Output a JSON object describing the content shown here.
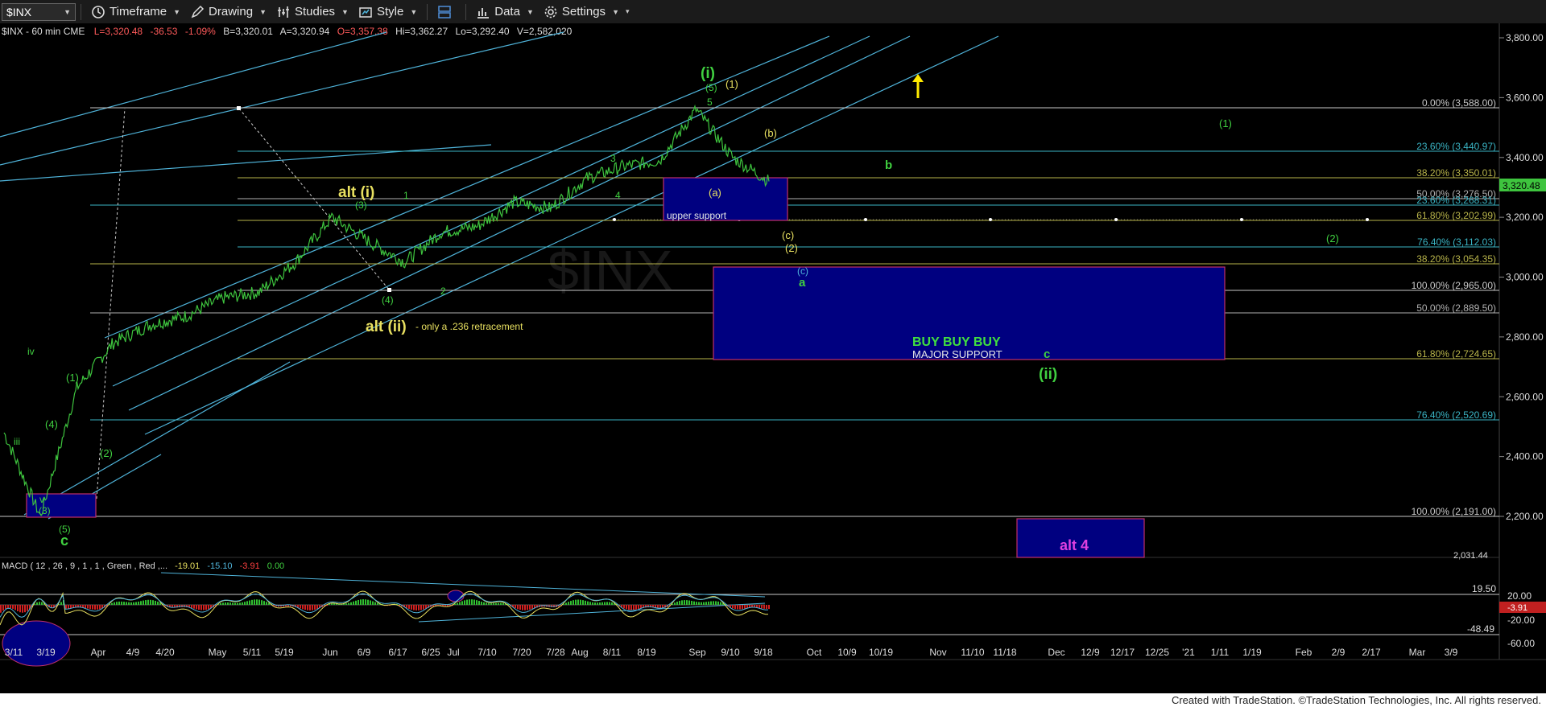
{
  "toolbar": {
    "symbol": "$INX",
    "timeframe": "Timeframe",
    "drawing": "Drawing",
    "studies": "Studies",
    "style": "Style",
    "data": "Data",
    "settings": "Settings"
  },
  "header": {
    "symbol_info": "$INX - 60 min  CME",
    "last": "L=3,320.48",
    "change": "-36.53",
    "change_pct": "-1.09%",
    "bid": "B=3,320.01",
    "ask": "A=3,320.94",
    "open": "O=3,357.38",
    "high": "Hi=3,362.27",
    "low": "Lo=3,292.40",
    "volume": "V=2,582,020"
  },
  "price_axis": {
    "ticks": [
      "3,800.00",
      "3,600.00",
      "3,400.00",
      "3,200.00",
      "3,000.00",
      "2,800.00",
      "2,600.00",
      "2,400.00",
      "2,200.00"
    ],
    "last_price": "3,320.48",
    "bottom_clip": "2,031.44"
  },
  "macd_axis": {
    "ticks": [
      "20.00",
      "-20.00",
      "-60.00"
    ],
    "upper_line": "19.50",
    "lower_line": "-48.49",
    "current": "-3.91"
  },
  "time_axis": [
    "3/11",
    "3/19",
    "Apr",
    "4/9",
    "4/20",
    "May",
    "5/11",
    "5/19",
    "Jun",
    "6/9",
    "6/17",
    "6/25",
    "Jul",
    "7/10",
    "7/20",
    "7/28",
    "Aug",
    "8/11",
    "8/19",
    "Sep",
    "9/10",
    "9/18",
    "Oct",
    "10/9",
    "10/19",
    "Nov",
    "11/10",
    "11/18",
    "Dec",
    "12/9",
    "12/17",
    "12/25",
    "'21",
    "1/11",
    "1/19",
    "Feb",
    "2/9",
    "2/17",
    "Mar",
    "3/9"
  ],
  "fib_levels": [
    {
      "label": "0.00% (3,588.00)",
      "color": "#c8c8c8"
    },
    {
      "label": "23.60% (3,440.97)",
      "color": "#3ab4c4"
    },
    {
      "label": "38.20% (3,350.01)",
      "color": "#b8b44a"
    },
    {
      "label": "50.00% (3,276.50)",
      "color": "#b0b0b0"
    },
    {
      "label": "23.60% (3,268.31)",
      "color": "#3ab4c4"
    },
    {
      "label": "61.80% (3,202.99)",
      "color": "#b8b44a"
    },
    {
      "label": "76.40% (3,112.03)",
      "color": "#3ab4c4"
    },
    {
      "label": "38.20% (3,054.35)",
      "color": "#b8b44a"
    },
    {
      "label": "100.00% (2,965.00)",
      "color": "#c8c8c8"
    },
    {
      "label": "50.00% (2,889.50)",
      "color": "#b0b0b0"
    },
    {
      "label": "61.80% (2,724.65)",
      "color": "#b8b44a"
    },
    {
      "label": "76.40% (2,520.69)",
      "color": "#3ab4c4"
    },
    {
      "label": "100.00% (2,191.00)",
      "color": "#c8c8c8"
    }
  ],
  "annotations": {
    "alt_i": "alt (i)",
    "alt_ii": "alt (ii)",
    "alt_ii_note": "- only a .236 retracement",
    "wave_i": "(i)",
    "wave_ii": "(ii)",
    "upper_support": "upper support",
    "buy": "BUY BUY BUY",
    "major_support": "MAJOR SUPPORT",
    "alt4": "alt 4",
    "b": "b",
    "c": "c",
    "a_green": "a",
    "c_paren": "(c)",
    "w1": "(1)",
    "w2": "(2)",
    "wa": "(a)",
    "wb": "(b)",
    "wc": "(c)",
    "w3": "(3)",
    "w4": "(4)",
    "w5": "(5)",
    "n1": "1",
    "n2": "2",
    "n3": "3",
    "n4": "4",
    "n5": "5",
    "iii": "iii",
    "iv": "iv",
    "v": "v",
    "bigC": "c"
  },
  "macd": {
    "label": "MACD ( 12 , 26 , 9 , 1 , 1 , Green , Red ,...",
    "v1": "-19.01",
    "v2": "-15.10",
    "v3": "-3.91",
    "v4": "0.00"
  },
  "footer": "Created with TradeStation. ©TradeStation Technologies, Inc. All rights reserved.",
  "colors": {
    "price_line": "#3ec43e",
    "channel": "#4fb3d9",
    "box_fill": "#000080",
    "box_border": "#c0306a",
    "yellow_label": "#e8e060",
    "green_label": "#40d040"
  },
  "chart_data": {
    "type": "line",
    "title": "",
    "xlabel": "",
    "ylabel": "",
    "ylim": [
      2031.44,
      3800
    ],
    "x": [
      "3/11",
      "3/19",
      "Apr",
      "4/9",
      "4/20",
      "May",
      "5/11",
      "5/19",
      "Jun",
      "6/9",
      "6/17",
      "6/25",
      "Jul",
      "7/10",
      "7/20",
      "7/28",
      "Aug",
      "8/11",
      "8/19",
      "Sep",
      "9/10",
      "9/18"
    ],
    "series": [
      {
        "values": [
          2480,
          2200,
          2630,
          2780,
          2840,
          2870,
          2930,
          2950,
          3050,
          3200,
          3120,
          3050,
          3150,
          3170,
          3250,
          3230,
          3330,
          3370,
          3390,
          3560,
          3400,
          3320
        ]
      }
    ]
  }
}
